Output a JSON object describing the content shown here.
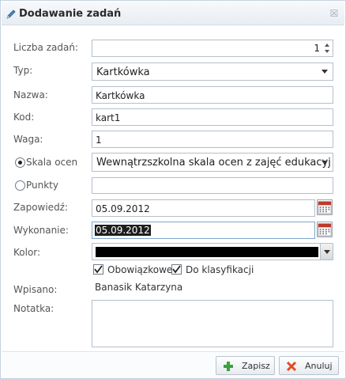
{
  "dialog": {
    "title": "Dodawanie zadań",
    "close_glyph": "☒"
  },
  "form": {
    "count": {
      "label": "Liczba zadań:",
      "value": "1"
    },
    "type": {
      "label": "Typ:",
      "value": "Kartkówka"
    },
    "name": {
      "label": "Nazwa:",
      "value": "Kartkówka"
    },
    "code": {
      "label": "Kod:",
      "value": "kart1"
    },
    "weight": {
      "label": "Waga:",
      "value": "1"
    },
    "grade_scale": {
      "label": "Skala ocen",
      "value": "Wewnątrzszkolna skala ocen z zajęć edukacyj",
      "checked": true
    },
    "points": {
      "label": "Punkty",
      "value": "",
      "checked": false
    },
    "announced": {
      "label": "Zapowiedź:",
      "value": "05.09.2012"
    },
    "done": {
      "label": "Wykonanie:",
      "value": "05.09.2012"
    },
    "color": {
      "label": "Kolor:",
      "value": "#000000"
    },
    "mandatory": {
      "label": "Obowiązkowe",
      "checked": true
    },
    "classification": {
      "label": "Do klasyfikacji",
      "checked": true
    },
    "entered_by": {
      "label": "Wpisano:",
      "value": "Banasik Katarzyna"
    },
    "note": {
      "label": "Notatka:",
      "value": ""
    }
  },
  "buttons": {
    "save": "Zapisz",
    "cancel": "Anuluj"
  },
  "colors": {
    "title_bg": "#e8edf3",
    "border": "#b5bfcc",
    "save_icon": "#3aa33a",
    "cancel_icon": "#e04a2a"
  },
  "icons": {
    "title": "pencil-icon",
    "close": "close-icon",
    "calendar": "calendar-icon",
    "save": "plus-icon",
    "cancel": "x-icon"
  }
}
